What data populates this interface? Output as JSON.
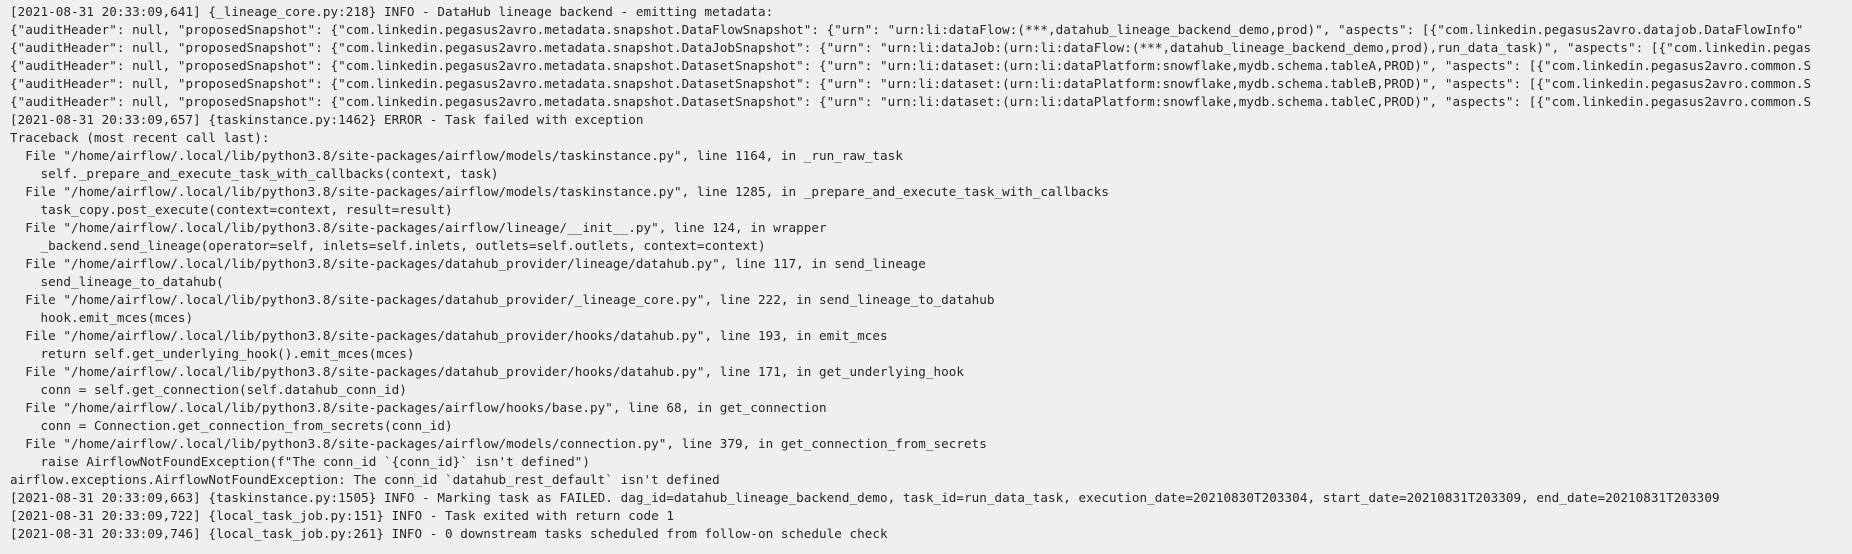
{
  "log": {
    "lines": [
      "[2021-08-31 20:33:09,641] {_lineage_core.py:218} INFO - DataHub lineage backend - emitting metadata:",
      "{\"auditHeader\": null, \"proposedSnapshot\": {\"com.linkedin.pegasus2avro.metadata.snapshot.DataFlowSnapshot\": {\"urn\": \"urn:li:dataFlow:(***,datahub_lineage_backend_demo,prod)\", \"aspects\": [{\"com.linkedin.pegasus2avro.datajob.DataFlowInfo\"",
      "{\"auditHeader\": null, \"proposedSnapshot\": {\"com.linkedin.pegasus2avro.metadata.snapshot.DataJobSnapshot\": {\"urn\": \"urn:li:dataJob:(urn:li:dataFlow:(***,datahub_lineage_backend_demo,prod),run_data_task)\", \"aspects\": [{\"com.linkedin.pegas",
      "{\"auditHeader\": null, \"proposedSnapshot\": {\"com.linkedin.pegasus2avro.metadata.snapshot.DatasetSnapshot\": {\"urn\": \"urn:li:dataset:(urn:li:dataPlatform:snowflake,mydb.schema.tableA,PROD)\", \"aspects\": [{\"com.linkedin.pegasus2avro.common.S",
      "{\"auditHeader\": null, \"proposedSnapshot\": {\"com.linkedin.pegasus2avro.metadata.snapshot.DatasetSnapshot\": {\"urn\": \"urn:li:dataset:(urn:li:dataPlatform:snowflake,mydb.schema.tableB,PROD)\", \"aspects\": [{\"com.linkedin.pegasus2avro.common.S",
      "{\"auditHeader\": null, \"proposedSnapshot\": {\"com.linkedin.pegasus2avro.metadata.snapshot.DatasetSnapshot\": {\"urn\": \"urn:li:dataset:(urn:li:dataPlatform:snowflake,mydb.schema.tableC,PROD)\", \"aspects\": [{\"com.linkedin.pegasus2avro.common.S",
      "[2021-08-31 20:33:09,657] {taskinstance.py:1462} ERROR - Task failed with exception",
      "Traceback (most recent call last):",
      "  File \"/home/airflow/.local/lib/python3.8/site-packages/airflow/models/taskinstance.py\", line 1164, in _run_raw_task",
      "    self._prepare_and_execute_task_with_callbacks(context, task)",
      "  File \"/home/airflow/.local/lib/python3.8/site-packages/airflow/models/taskinstance.py\", line 1285, in _prepare_and_execute_task_with_callbacks",
      "    task_copy.post_execute(context=context, result=result)",
      "  File \"/home/airflow/.local/lib/python3.8/site-packages/airflow/lineage/__init__.py\", line 124, in wrapper",
      "    _backend.send_lineage(operator=self, inlets=self.inlets, outlets=self.outlets, context=context)",
      "  File \"/home/airflow/.local/lib/python3.8/site-packages/datahub_provider/lineage/datahub.py\", line 117, in send_lineage",
      "    send_lineage_to_datahub(",
      "  File \"/home/airflow/.local/lib/python3.8/site-packages/datahub_provider/_lineage_core.py\", line 222, in send_lineage_to_datahub",
      "    hook.emit_mces(mces)",
      "  File \"/home/airflow/.local/lib/python3.8/site-packages/datahub_provider/hooks/datahub.py\", line 193, in emit_mces",
      "    return self.get_underlying_hook().emit_mces(mces)",
      "  File \"/home/airflow/.local/lib/python3.8/site-packages/datahub_provider/hooks/datahub.py\", line 171, in get_underlying_hook",
      "    conn = self.get_connection(self.datahub_conn_id)",
      "  File \"/home/airflow/.local/lib/python3.8/site-packages/airflow/hooks/base.py\", line 68, in get_connection",
      "    conn = Connection.get_connection_from_secrets(conn_id)",
      "  File \"/home/airflow/.local/lib/python3.8/site-packages/airflow/models/connection.py\", line 379, in get_connection_from_secrets",
      "    raise AirflowNotFoundException(f\"The conn_id `{conn_id}` isn't defined\")",
      "airflow.exceptions.AirflowNotFoundException: The conn_id `datahub_rest_default` isn't defined",
      "[2021-08-31 20:33:09,663] {taskinstance.py:1505} INFO - Marking task as FAILED. dag_id=datahub_lineage_backend_demo, task_id=run_data_task, execution_date=20210830T203304, start_date=20210831T203309, end_date=20210831T203309",
      "[2021-08-31 20:33:09,722] {local_task_job.py:151} INFO - Task exited with return code 1",
      "[2021-08-31 20:33:09,746] {local_task_job.py:261} INFO - 0 downstream tasks scheduled from follow-on schedule check"
    ]
  }
}
